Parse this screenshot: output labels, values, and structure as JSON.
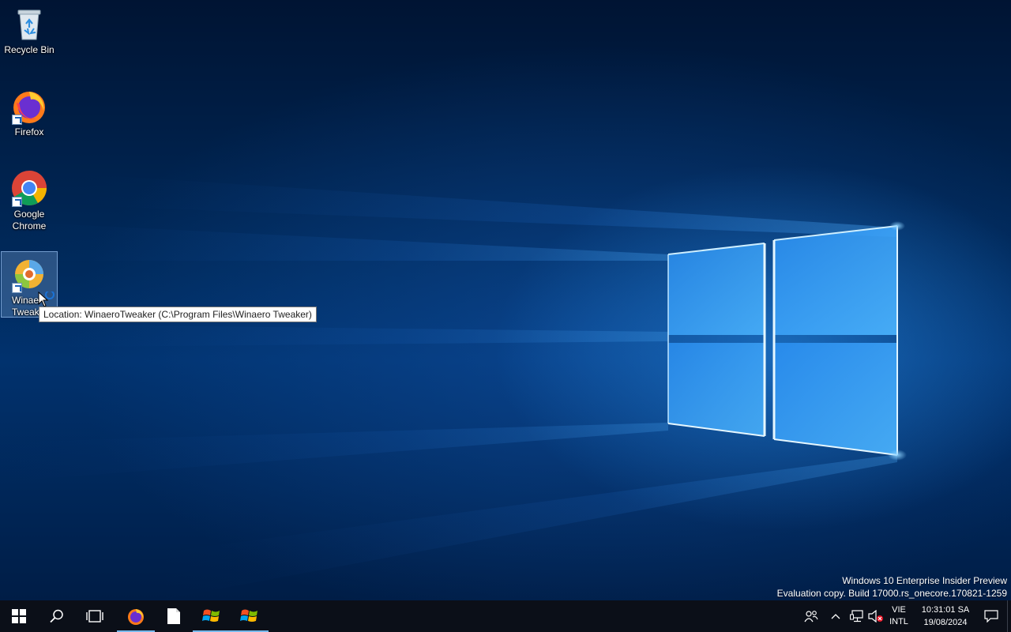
{
  "desktop_icons": [
    {
      "label": "Recycle Bin"
    },
    {
      "label": "Firefox"
    },
    {
      "label": "Google Chrome"
    },
    {
      "label": "Winaero Tweaker",
      "label_visible": "Winae\nTweak"
    }
  ],
  "tooltip": {
    "text": "Location: WinaeroTweaker (C:\\Program Files\\Winaero Tweaker)"
  },
  "watermark": {
    "line1": "Windows 10 Enterprise Insider Preview",
    "line2": "Evaluation copy. Build 17000.rs_onecore.170821-1259"
  },
  "taskbar": {
    "pinned": [
      {
        "name": "start-button",
        "icon": "windows-logo-icon"
      },
      {
        "name": "search-button",
        "icon": "search-icon"
      },
      {
        "name": "task-view-button",
        "icon": "task-view-icon"
      },
      {
        "name": "firefox-taskbar-button",
        "icon": "firefox-icon",
        "active": true
      },
      {
        "name": "file-taskbar-button",
        "icon": "document-icon"
      },
      {
        "name": "app-taskbar-button-1",
        "icon": "windows-flag-icon",
        "active": true
      },
      {
        "name": "app-taskbar-button-2",
        "icon": "windows-flag-icon",
        "active": true
      }
    ],
    "tray": {
      "language_line1": "VIE",
      "language_line2": "INTL",
      "time": "10:31:01 SA",
      "date": "19/08/2024"
    }
  },
  "colors": {
    "taskbar_bg": "#0b0f18",
    "accent": "#76b9ed",
    "wallpaper_glow": "#2f9bff"
  }
}
